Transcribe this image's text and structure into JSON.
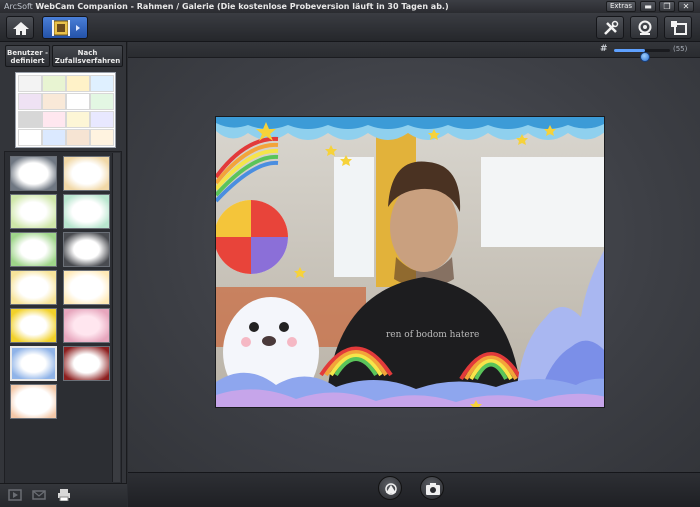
{
  "window": {
    "brand": "ArcSoft",
    "title": "WebCam Companion - Rahmen / Galerie (Die kostenlose Probeversion läuft in 30 Tagen ab.)",
    "extras_label": "Extras",
    "minimize_glyph": "▬",
    "restore_glyph": "❐",
    "close_glyph": "✕"
  },
  "toolbar": {
    "home_icon": "home-icon",
    "frames_icon": "film-frames-icon",
    "tools_icon": "tools-icon",
    "webcam_icon": "webcam-icon",
    "gallery_icon": "gallery-icon"
  },
  "sidebar": {
    "category_buttons": [
      "Benutzer -definiert",
      "Nach Zufallsverfahren"
    ],
    "thumbnails": [
      {
        "name": "frame-1"
      },
      {
        "name": "frame-2"
      },
      {
        "name": "frame-3"
      },
      {
        "name": "frame-4"
      },
      {
        "name": "frame-5"
      },
      {
        "name": "frame-6"
      },
      {
        "name": "frame-7"
      },
      {
        "name": "frame-8"
      },
      {
        "name": "frame-9"
      },
      {
        "name": "frame-10"
      },
      {
        "name": "frame-11"
      },
      {
        "name": "frame-12"
      },
      {
        "name": "frame-13"
      }
    ],
    "selected_thumbnail": 10
  },
  "zoom": {
    "icon": "zoom-grid-icon",
    "value_label": "(55)",
    "fraction": 0.55
  },
  "capture": {
    "effects_icon": "effects-icon",
    "camera_icon": "camera-icon"
  },
  "colors": {
    "accent": "#3a70d0",
    "background": "#2a2c31",
    "stage": "#45474d"
  }
}
